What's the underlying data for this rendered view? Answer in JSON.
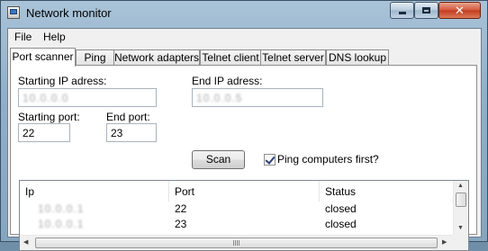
{
  "window": {
    "title": "Network monitor"
  },
  "menu": {
    "file": "File",
    "help": "Help"
  },
  "tabs": [
    {
      "label": "Port scanner",
      "active": true
    },
    {
      "label": "Ping"
    },
    {
      "label": "Network adapters"
    },
    {
      "label": "Telnet client"
    },
    {
      "label": "Telnet server"
    },
    {
      "label": "DNS lookup"
    }
  ],
  "scanner": {
    "start_ip_label": "Starting IP adress:",
    "start_ip_value": "10.0.0.0",
    "end_ip_label": "End IP adress:",
    "end_ip_value": "10.0.0.5",
    "start_port_label": "Starting port:",
    "start_port_value": "22",
    "end_port_label": "End port:",
    "end_port_value": "23",
    "scan_label": "Scan",
    "ping_first_label": "Ping computers first?",
    "ping_first_checked": true
  },
  "results": {
    "columns": [
      "Ip",
      "Port",
      "Status"
    ],
    "rows": [
      {
        "ip": "10.0.0.1",
        "port": "22",
        "status": "closed"
      },
      {
        "ip": "10.0.0.1",
        "port": "23",
        "status": "closed"
      }
    ]
  }
}
